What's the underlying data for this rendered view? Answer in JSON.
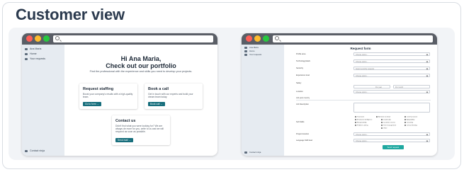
{
  "title": "Customer view",
  "left_window": {
    "sidebar": {
      "user": "Ana Maria",
      "items": [
        "Home",
        "Your requests"
      ],
      "footer": "Contact ninja"
    },
    "greeting_line1": "Hi Ana Maria,",
    "greeting_line2": "Check out our portfolio",
    "subtitle": "Find the professional with the experience and skills you need to develop your projects.",
    "cards": [
      {
        "title": "Request staffing",
        "desc": "Boost your company's results with a high-quality team.",
        "button": "Go to form →"
      },
      {
        "title": "Book a call",
        "desc": "Get in touch with our experts and build your dream team today.",
        "button": "Book call →"
      },
      {
        "title": "Contact us",
        "desc": "Didn't find what you were looking for? We are always de more for you, write to us and we will respond as soon as possible.",
        "button": "Send mail →"
      }
    ]
  },
  "right_window": {
    "sidebar": {
      "user": "Ana Maria",
      "items": [
        "Home",
        "Your requests"
      ],
      "footer": "Contact ninja"
    },
    "form_title": "Request form",
    "fields": [
      {
        "label": "Profile area",
        "value": "Choose option..."
      },
      {
        "label": "Technology/stack",
        "value": "Choose option..."
      },
      {
        "label": "Seniority",
        "value": "Select seniority requests"
      },
      {
        "label": "Experience level",
        "value": "Choose option..."
      },
      {
        "label": "Salary",
        "value": ""
      },
      {
        "label": "Location",
        "value": "Choose option..."
      },
      {
        "label": "Job post country",
        "value": ""
      },
      {
        "label": "Job Description",
        "value": ""
      },
      {
        "label": "Soft Skills",
        "value": ""
      },
      {
        "label": "Project duration",
        "value": "Choose option..."
      },
      {
        "label": "Language Skill level",
        "value": "Choose option..."
      }
    ],
    "salary_options": [
      "Per year",
      "Per month"
    ],
    "soft_skills": [
      "Teamwork",
      "Attention to detail",
      "Communication",
      "Emotional intelligence",
      "Leadership",
      "Adaptability",
      "Responsibility",
      "Customer service",
      "Creativity",
      "Problem solving",
      "Time management",
      "Critical thinking",
      "Other"
    ],
    "submit": "Send request"
  }
}
